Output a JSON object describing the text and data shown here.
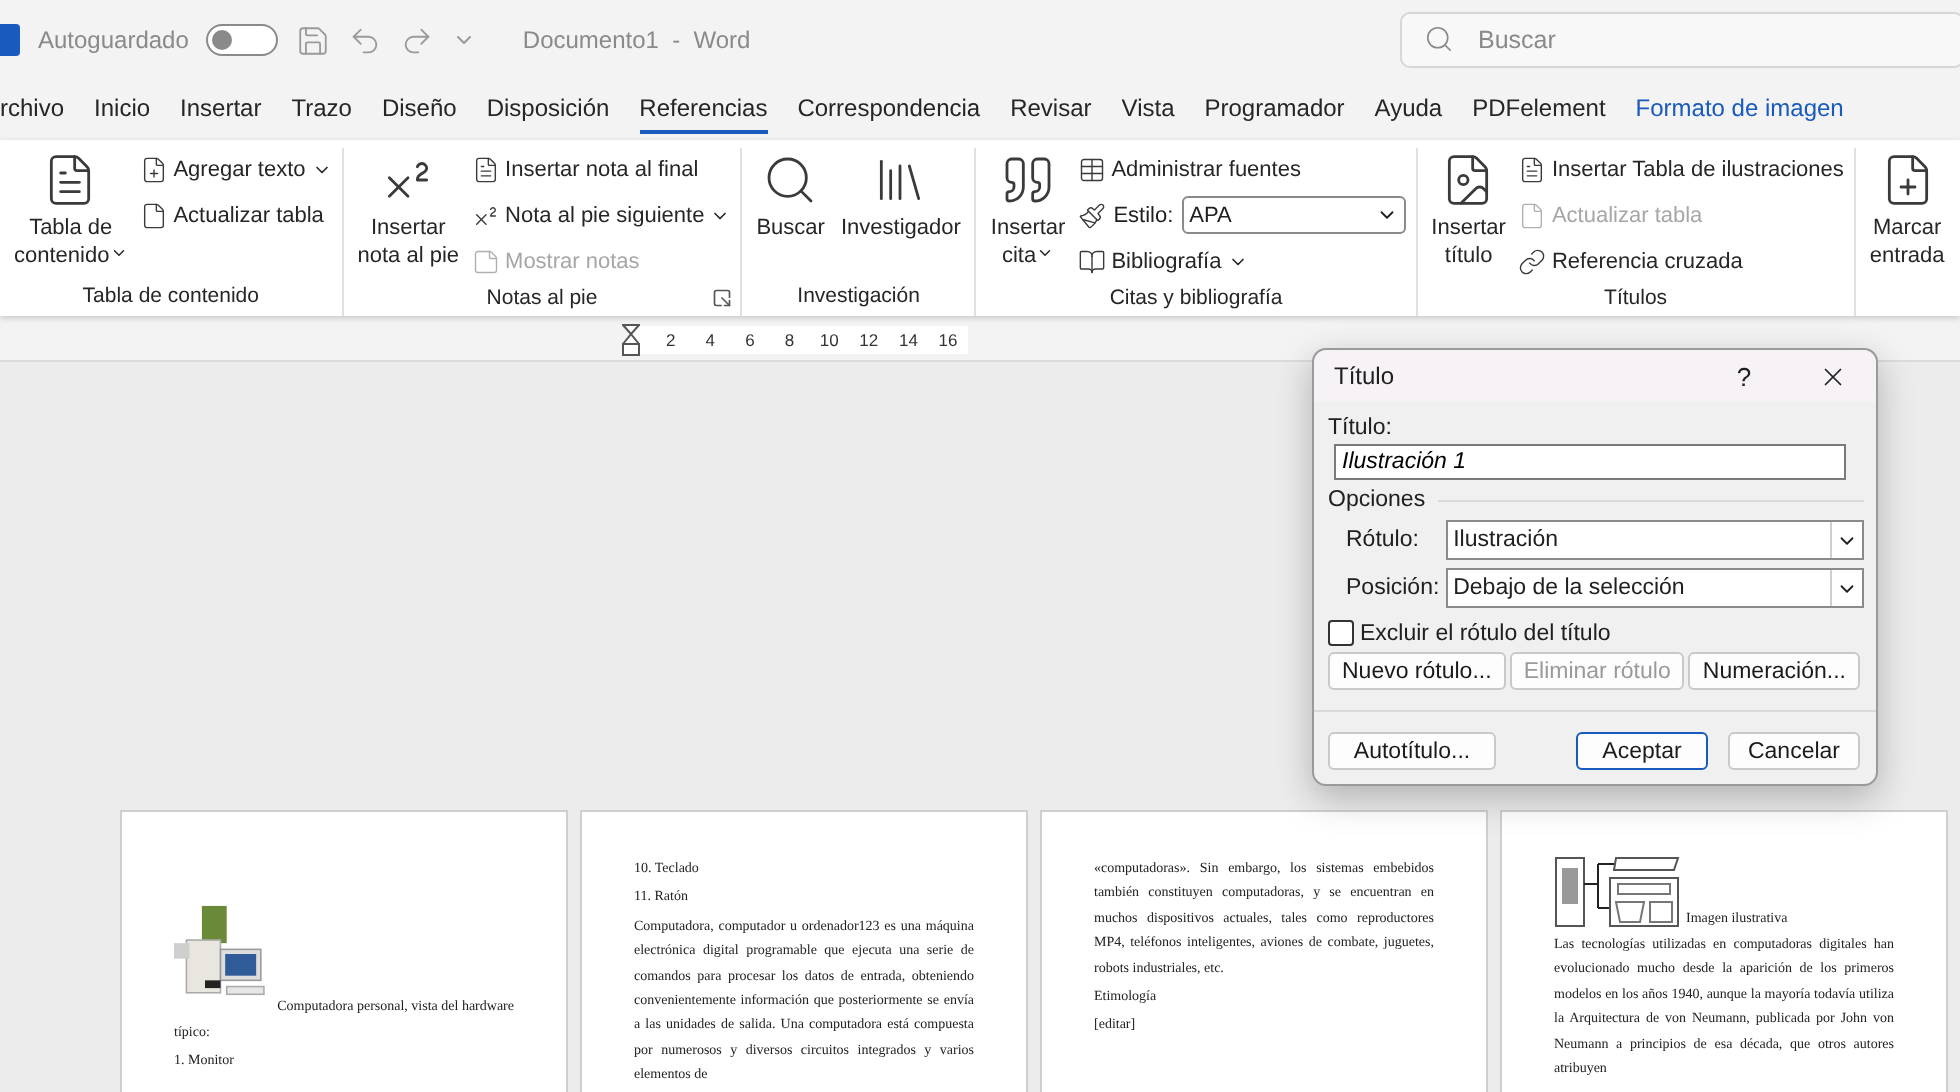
{
  "title_bar": {
    "autosave_label": "Autoguardado",
    "autosave_on": false,
    "document_title": "Documento1  -  Word",
    "search": {
      "placeholder": "Buscar"
    }
  },
  "tabs": [
    {
      "label": "rchivo",
      "selected": false,
      "kind": "normal"
    },
    {
      "label": "Inicio",
      "selected": false,
      "kind": "normal"
    },
    {
      "label": "Insertar",
      "selected": false,
      "kind": "normal"
    },
    {
      "label": "Trazo",
      "selected": false,
      "kind": "normal"
    },
    {
      "label": "Diseño",
      "selected": false,
      "kind": "normal"
    },
    {
      "label": "Disposición",
      "selected": false,
      "kind": "normal"
    },
    {
      "label": "Referencias",
      "selected": true,
      "kind": "normal"
    },
    {
      "label": "Correspondencia",
      "selected": false,
      "kind": "normal"
    },
    {
      "label": "Revisar",
      "selected": false,
      "kind": "normal"
    },
    {
      "label": "Vista",
      "selected": false,
      "kind": "normal"
    },
    {
      "label": "Programador",
      "selected": false,
      "kind": "normal"
    },
    {
      "label": "Ayuda",
      "selected": false,
      "kind": "normal"
    },
    {
      "label": "PDFelement",
      "selected": false,
      "kind": "normal"
    },
    {
      "label": "Formato de imagen",
      "selected": false,
      "kind": "contextual"
    }
  ],
  "ribbon": {
    "groups": [
      {
        "label": "Tabla de contenido",
        "launcher": false,
        "items": [
          {
            "kind": "large",
            "label": "Tabla de\ncontenido",
            "caret": true,
            "disabled": false
          },
          {
            "kind": "small",
            "label": "Agregar texto",
            "caret": true,
            "disabled": false
          },
          {
            "kind": "small",
            "label": "Actualizar tabla",
            "caret": false,
            "disabled": false
          }
        ]
      },
      {
        "label": "Notas al pie",
        "launcher": true,
        "items": [
          {
            "kind": "large",
            "label": "Insertar\nnota al pie",
            "caret": false,
            "disabled": false
          },
          {
            "kind": "small",
            "label": "Insertar nota al final",
            "caret": false,
            "disabled": false
          },
          {
            "kind": "small",
            "label": "Nota al pie siguiente",
            "caret": true,
            "disabled": false
          },
          {
            "kind": "small",
            "label": "Mostrar notas",
            "caret": false,
            "disabled": true
          }
        ]
      },
      {
        "label": "Investigación",
        "launcher": false,
        "items": [
          {
            "kind": "large",
            "label": "Buscar",
            "caret": false,
            "disabled": false
          },
          {
            "kind": "large",
            "label": "Investigador",
            "caret": false,
            "disabled": false
          }
        ]
      },
      {
        "label": "Citas y bibliografía",
        "launcher": false,
        "items": [
          {
            "kind": "large",
            "label": "Insertar\ncita",
            "caret": true,
            "disabled": false
          },
          {
            "kind": "small",
            "label": "Administrar fuentes",
            "caret": false,
            "disabled": false
          },
          {
            "kind": "select",
            "label": "Estilo:",
            "value": "APA"
          },
          {
            "kind": "small",
            "label": "Bibliografía",
            "caret": true,
            "disabled": false
          }
        ]
      },
      {
        "label": "Títulos",
        "launcher": false,
        "items": [
          {
            "kind": "large",
            "label": "Insertar\ntítulo",
            "caret": false,
            "disabled": false
          },
          {
            "kind": "small",
            "label": "Insertar Tabla de ilustraciones",
            "caret": false,
            "disabled": false
          },
          {
            "kind": "small",
            "label": "Actualizar tabla",
            "caret": false,
            "disabled": true
          },
          {
            "kind": "small",
            "label": "Referencia cruzada",
            "caret": false,
            "disabled": false
          }
        ]
      },
      {
        "items": [
          {
            "kind": "large",
            "label": "Marcar\nentrada",
            "caret": false,
            "disabled": false
          }
        ]
      }
    ]
  },
  "ruler": {
    "numbers": [
      "2",
      "4",
      "6",
      "8",
      "10",
      "12",
      "14",
      "16"
    ]
  },
  "pages": [
    {
      "blocks": [
        {
          "kind": "figure",
          "caption": "Computadora personal, vista del hardware"
        },
        {
          "kind": "paragraph",
          "text": "típico:"
        },
        {
          "kind": "paragraph",
          "text": "1. Monitor"
        }
      ]
    },
    {
      "blocks": [
        {
          "kind": "paragraph",
          "text": "10. Teclado"
        },
        {
          "kind": "paragraph",
          "text": "11. Ratón"
        },
        {
          "kind": "paragraph",
          "text": "Computadora, computador u ordenador123 es una máquina electrónica digital programable que ejecuta una serie de comandos para procesar los datos de entrada, obteniendo convenientemente información que posteriormente se envía a las unidades de salida. Una computadora está compuesta por numerosos y diversos circuitos integrados y varios elementos de"
        }
      ]
    },
    {
      "blocks": [
        {
          "kind": "paragraph",
          "text": "«computadoras». Sin embargo, los sistemas embebidos también constituyen computadoras, y se encuentran en muchos dispositivos actuales, tales como reproductores MP4, teléfonos inteligentes, aviones de combate, juguetes, robots industriales, etc."
        },
        {
          "kind": "paragraph",
          "text": "Etimología"
        },
        {
          "kind": "paragraph",
          "text": "[editar]"
        }
      ]
    },
    {
      "blocks": [
        {
          "kind": "figure",
          "caption": "Imagen ilustrativa"
        },
        {
          "kind": "paragraph",
          "text": "Las tecnologías utilizadas en computadoras digitales han evolucionado mucho desde la aparición de los primeros modelos en los años 1940, aunque la mayoría todavía utiliza la Arquitectura de von Neumann, publicada por John von Neumann a principios de esa década, que otros autores atribuyen"
        }
      ]
    }
  ],
  "dialog": {
    "title": "Título",
    "help": "?",
    "field_label": "Título:",
    "field_value": "Ilustración 1",
    "options_label": "Opciones",
    "selects": [
      {
        "label": "Rótulo:",
        "value": "Ilustración"
      },
      {
        "label": "Posición:",
        "value": "Debajo de la selección"
      }
    ],
    "exclude": {
      "label": "Excluir el rótulo del título",
      "checked": false
    },
    "buttons": [
      {
        "label": "Nuevo rótulo...",
        "disabled": false,
        "default": false
      },
      {
        "label": "Eliminar rótulo",
        "disabled": true,
        "default": false
      },
      {
        "label": "Numeración...",
        "disabled": false,
        "default": false
      }
    ],
    "footer_buttons": [
      {
        "label": "Autotítulo...",
        "disabled": false,
        "default": false
      },
      {
        "label": "Aceptar",
        "disabled": false,
        "default": true
      },
      {
        "label": "Cancelar",
        "disabled": false,
        "default": false
      }
    ]
  }
}
